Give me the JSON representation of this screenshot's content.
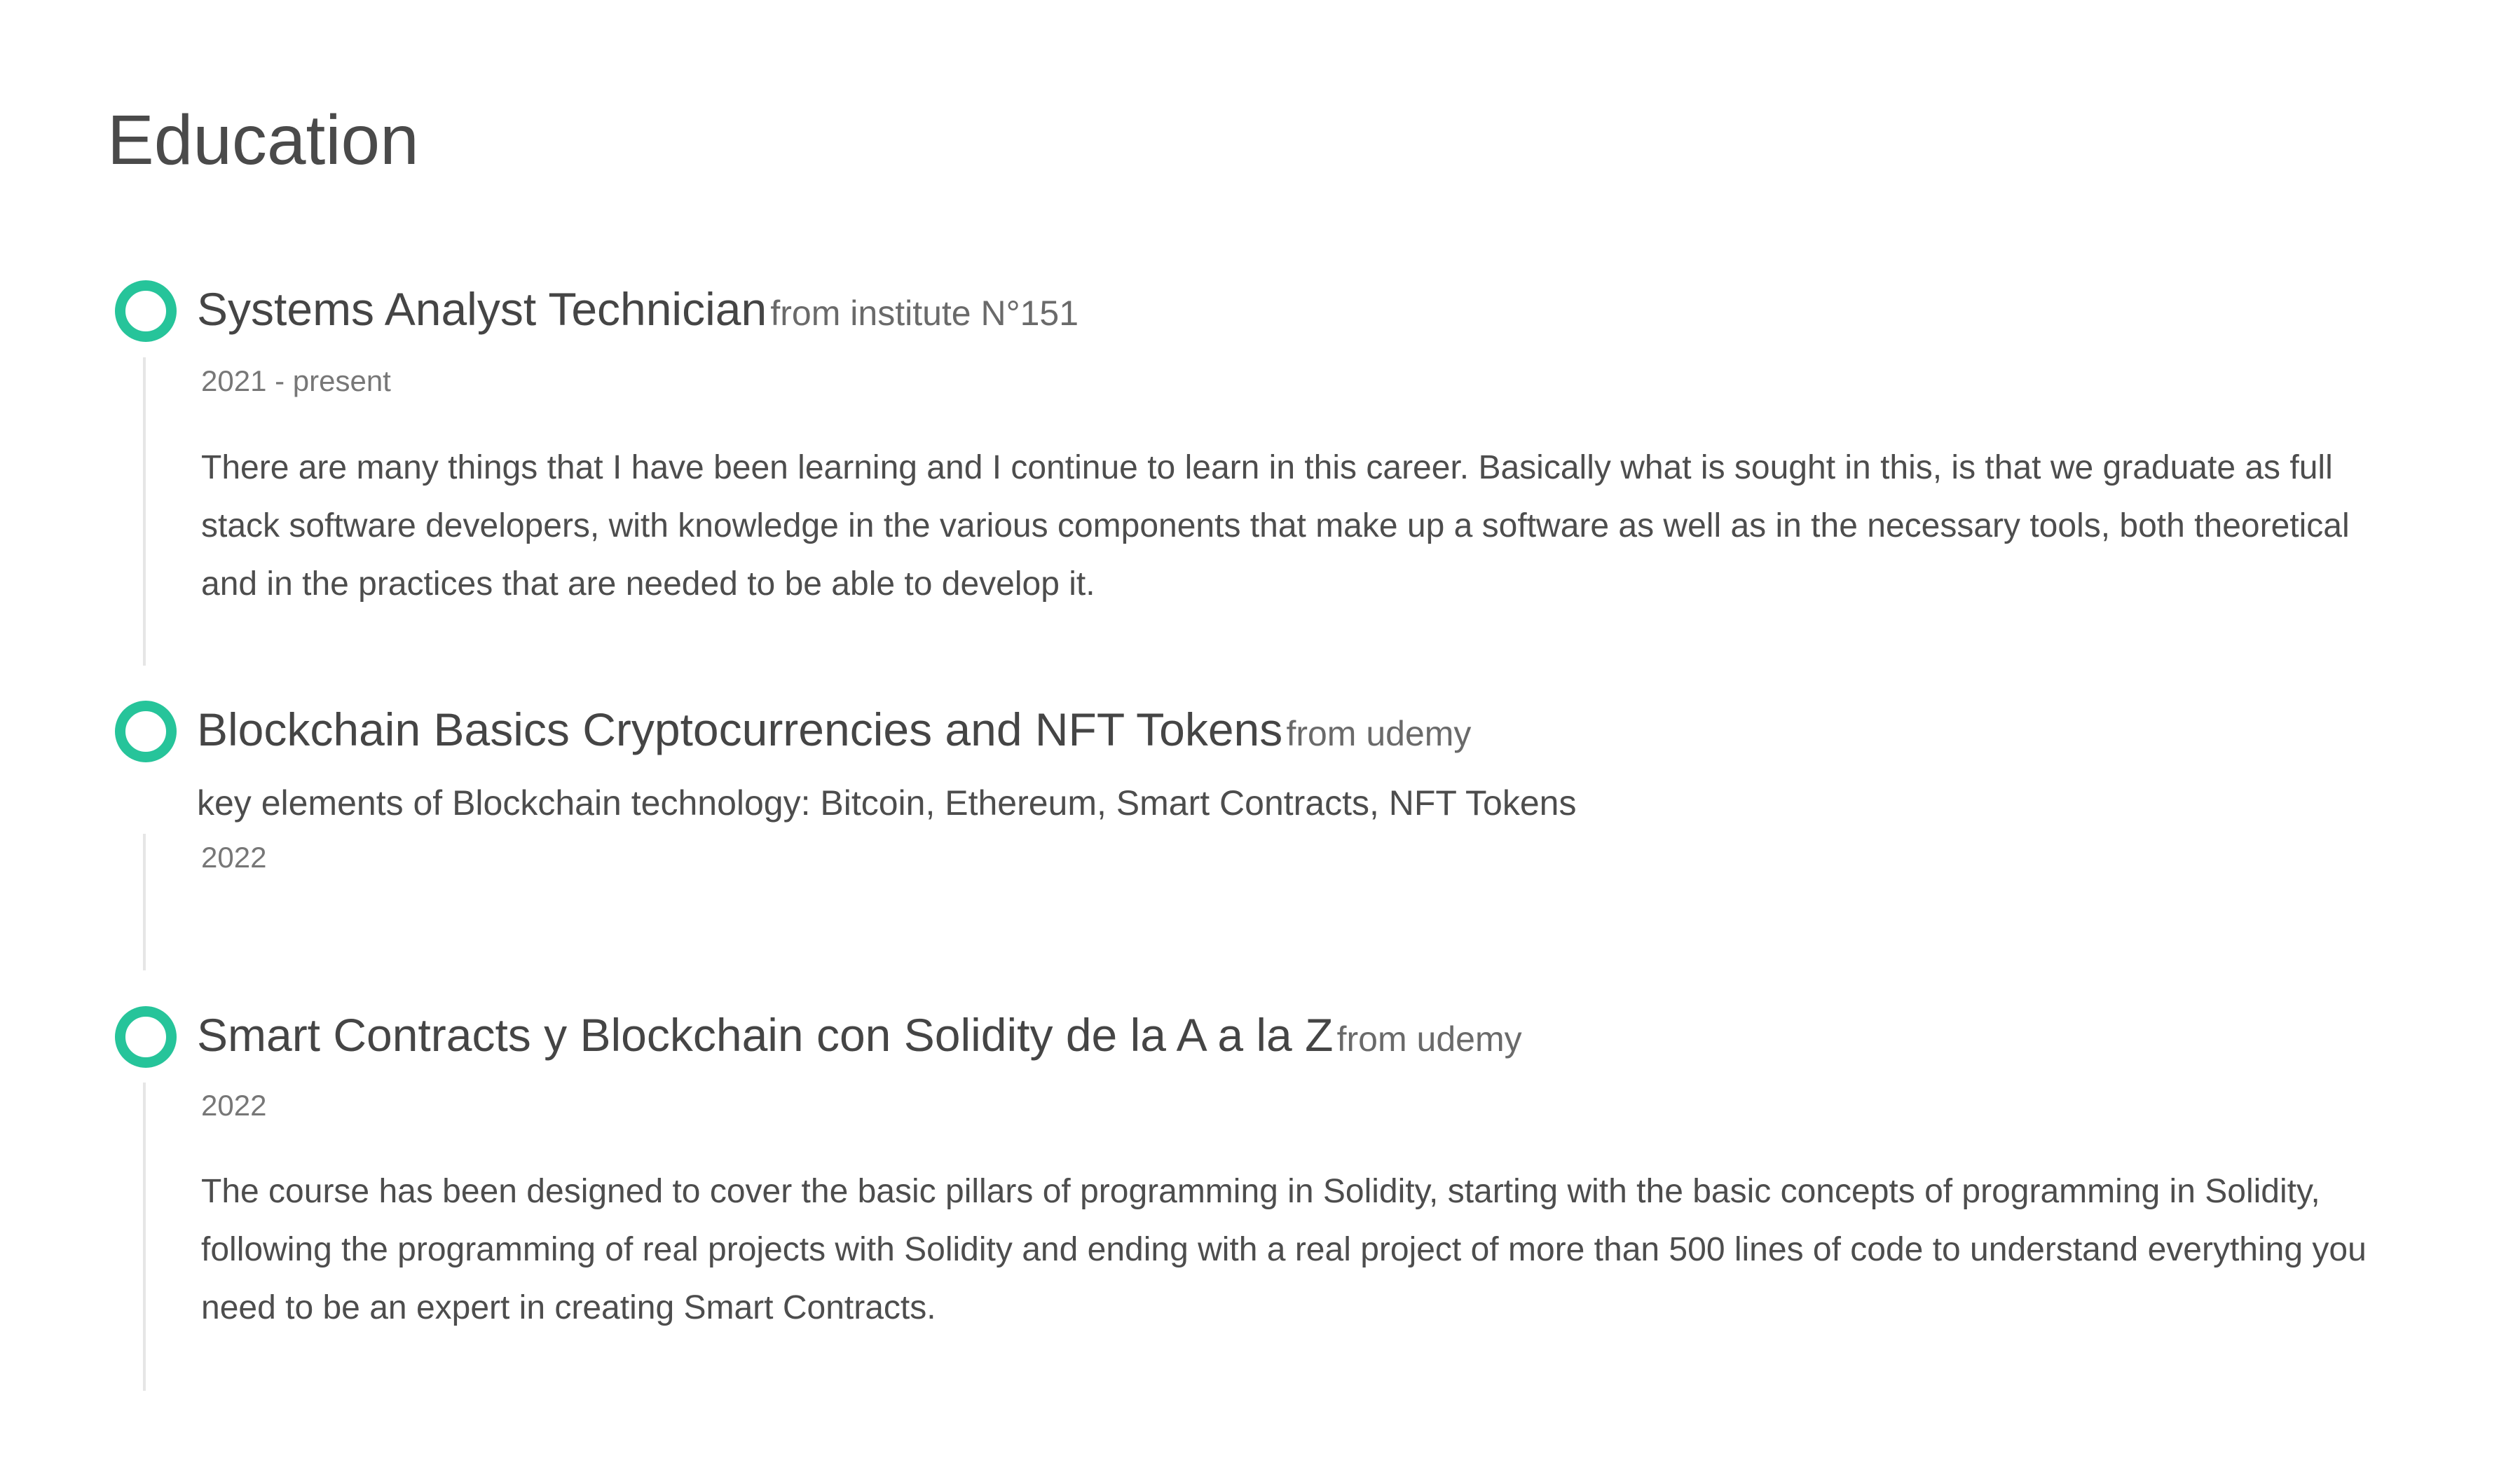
{
  "section": {
    "title": "Education"
  },
  "colors": {
    "accent": "#26c49a",
    "timeline_line": "#e6e6e6",
    "heading_text": "#454545",
    "muted_text": "#777777"
  },
  "items": [
    {
      "title": "Systems Analyst Technician",
      "from": "from institute N°151",
      "date": "2021 - present",
      "description": "There are many things that I have been learning and I continue to learn in this career. Basically what is sought in this, is that we graduate as full stack software developers, with knowledge in the various components that make up a software as well as in the necessary tools, both theoretical and in the practices that are needed to be able to develop it."
    },
    {
      "title": "Blockchain Basics Cryptocurrencies and NFT Tokens",
      "from": "from udemy",
      "subtitle": "key elements of Blockchain technology: Bitcoin, Ethereum, Smart Contracts, NFT Tokens",
      "date": "2022"
    },
    {
      "title": "Smart Contracts y Blockchain con Solidity de la A a la Z",
      "from": "from udemy",
      "date": "2022",
      "description": "The course has been designed to cover the basic pillars of programming in Solidity, starting with the basic concepts of programming in Solidity, following the programming of real projects with Solidity and ending with a real project of more than 500 lines of code to understand everything you need to be an expert in creating Smart Contracts."
    }
  ]
}
